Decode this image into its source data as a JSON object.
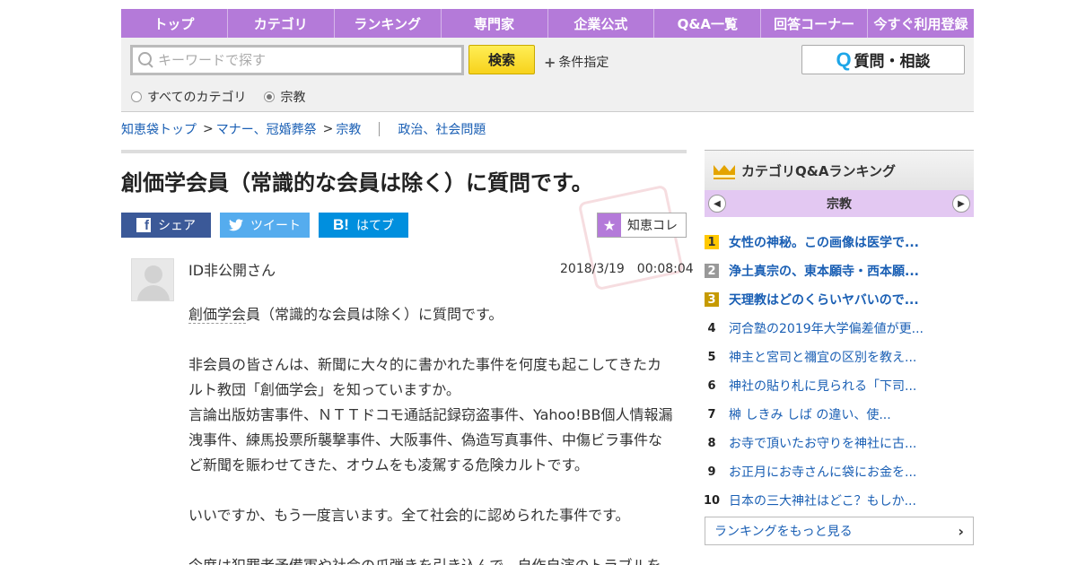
{
  "nav": [
    "トップ",
    "カテゴリ",
    "ランキング",
    "専門家",
    "企業公式",
    "Q&A一覧",
    "回答コーナー",
    "今すぐ利用登録"
  ],
  "search": {
    "placeholder": "キーワードで探す",
    "button": "検索",
    "conditions": "条件指定",
    "ask_button": "質問・相談",
    "radio_all": "すべてのカテゴリ",
    "radio_current": "宗教"
  },
  "breadcrumb": {
    "top": "知恵袋トップ",
    "cat1": "マナー、冠婚葬祭",
    "cat2": "宗教",
    "related": "政治、社会問題"
  },
  "question": {
    "title": "創価学会員（常識的な会員は除く）に質問です。",
    "share_fb": "シェア",
    "share_tw": "ツイート",
    "share_hb": "はてブ",
    "collect": "知恵コレ",
    "user": "ID非公開さん",
    "date": "2018/3/19　00:08:04",
    "keyword": "創価学会",
    "line1_rest": "員（常識的な会員は除く）に質問です。",
    "p2": "非会員の皆さんは、新聞に大々的に書かれた事件を何度も起こしてきたカルト教団「創価学会」を知っていますか。",
    "p3": "言論出版妨害事件、ＮＴＴドコモ通話記録窃盗事件、Yahoo!BB個人情報漏洩事件、練馬投票所襲撃事件、大阪事件、偽造写真事件、中傷ビラ事件など新聞を賑わせてきた、オウムをも凌駕する危険カルトです。",
    "p4": "いいですか、もう一度言います。全て社会的に認められた事件です。",
    "p5": "今度は犯罪者予備軍や社会の爪弾きを引き込んで、自作自演のトラブルを"
  },
  "ranking": {
    "title": "カテゴリQ&Aランキング",
    "category": "宗教",
    "items": [
      {
        "rank": "1",
        "text": "女性の神秘。この画像は医学で..."
      },
      {
        "rank": "2",
        "text": "浄土真宗の、東本願寺・西本願..."
      },
      {
        "rank": "3",
        "text": "天理教はどのくらいヤバいので..."
      },
      {
        "rank": "4",
        "text": "河合塾の2019年大学偏差値が更..."
      },
      {
        "rank": "5",
        "text": "神主と宮司と禰宜の区別を教え..."
      },
      {
        "rank": "6",
        "text": "神社の貼り札に見られる「下司..."
      },
      {
        "rank": "7",
        "text": "榊 しきみ しば の違い、使..."
      },
      {
        "rank": "8",
        "text": "お寺で頂いたお守りを神社に古..."
      },
      {
        "rank": "9",
        "text": "お正月にお寺さんに袋にお金を..."
      },
      {
        "rank": "10",
        "text": "日本の三大神社はどこ？もしか..."
      }
    ],
    "more": "ランキングをもっと見る"
  }
}
